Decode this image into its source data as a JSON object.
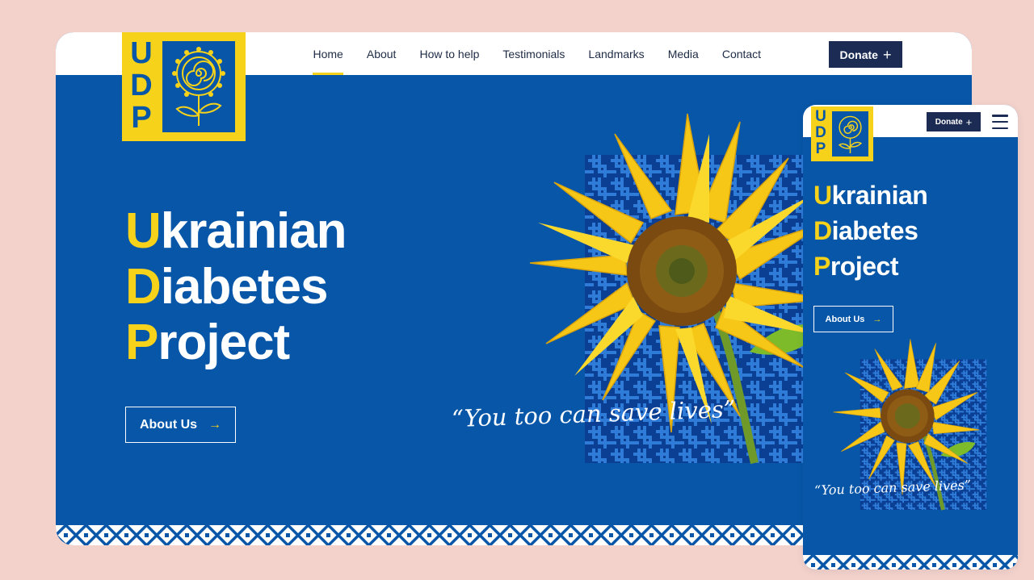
{
  "brand": {
    "logo_letters": [
      "U",
      "D",
      "P"
    ],
    "colors": {
      "blue": "#0756a8",
      "yellow": "#f6d31a",
      "navy": "#1b2b53",
      "background": "#f3d2cc"
    }
  },
  "desktop": {
    "nav": {
      "items": [
        "Home",
        "About",
        "How to help",
        "Testimonials",
        "Landmarks",
        "Media",
        "Contact"
      ],
      "active": "Home"
    },
    "donate_label": "Donate",
    "donate_icon": "plus-icon",
    "hero": {
      "title_lines": [
        {
          "cap": "U",
          "rest": "krainian"
        },
        {
          "cap": "D",
          "rest": "iabetes"
        },
        {
          "cap": "P",
          "rest": "roject"
        }
      ],
      "about_label": "About Us",
      "about_icon": "arrow-right-icon",
      "quote": "“You too can save lives”"
    }
  },
  "mobile": {
    "donate_label": "Donate",
    "menu_icon": "hamburger-menu-icon",
    "hero": {
      "title_lines": [
        {
          "cap": "U",
          "rest": "krainian"
        },
        {
          "cap": "D",
          "rest": "iabetes"
        },
        {
          "cap": "P",
          "rest": "roject"
        }
      ],
      "about_label": "About Us",
      "quote": "“You too can save lives”"
    }
  }
}
